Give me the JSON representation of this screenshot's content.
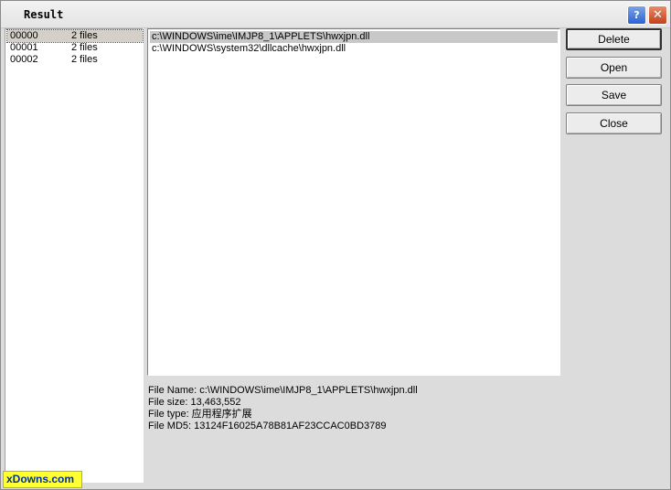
{
  "window": {
    "title": "Result"
  },
  "titlebar": {
    "help_glyph": "?",
    "close_glyph": "✕"
  },
  "groups": [
    {
      "id": "00000",
      "count": "2 files",
      "selected": true
    },
    {
      "id": "00001",
      "count": "2 files",
      "selected": false
    },
    {
      "id": "00002",
      "count": "2 files",
      "selected": false
    }
  ],
  "files": [
    {
      "path": "c:\\WINDOWS\\ime\\IMJP8_1\\APPLETS\\hwxjpn.dll",
      "selected": true
    },
    {
      "path": "c:\\WINDOWS\\system32\\dllcache\\hwxjpn.dll",
      "selected": false
    }
  ],
  "info": {
    "name": "File Name: c:\\WINDOWS\\ime\\IMJP8_1\\APPLETS\\hwxjpn.dll",
    "size": "File size: 13,463,552",
    "type": "File type: 应用程序扩展",
    "md5": "File MD5: 13124F16025A78B81AF23CCAC0BD3789"
  },
  "buttons": {
    "delete": "Delete",
    "open": "Open",
    "save": "Save",
    "close": "Close"
  },
  "watermark": "xDowns.com"
}
